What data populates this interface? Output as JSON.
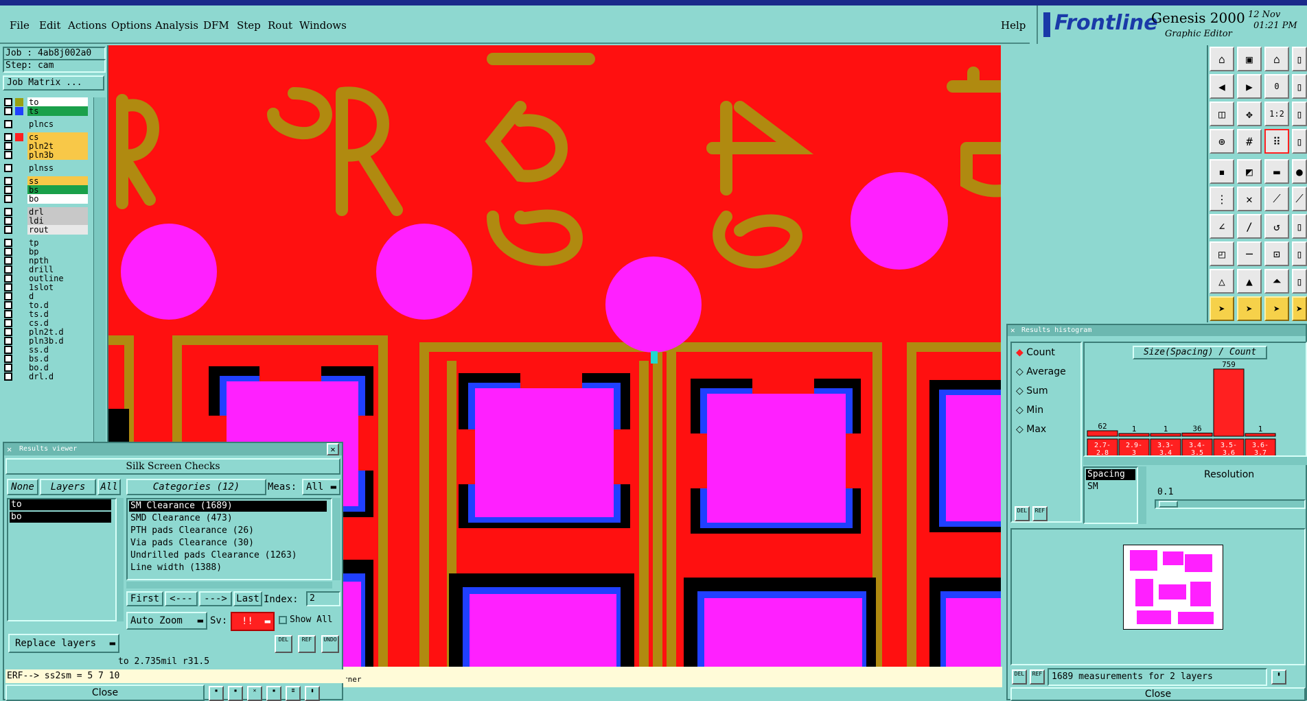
{
  "menu": {
    "items": [
      "File",
      "Edit",
      "Actions",
      "Options",
      "Analysis",
      "DFM",
      "Step",
      "Rout",
      "Windows"
    ],
    "help": "Help"
  },
  "brand": {
    "logo": "Frontline",
    "product": "Genesis 2000",
    "subtitle": "Graphic Editor",
    "date": "12 Nov",
    "time": "01:21 PM"
  },
  "job": {
    "job_label": "Job : 4ab8j002a0",
    "step_label": "Step: cam",
    "matrix_button": "Job Matrix ..."
  },
  "layers": [
    {
      "name": "to",
      "color": "#ffffff",
      "swatch": "#9aa010",
      "style": "active"
    },
    {
      "name": "ts",
      "color": "#1aa04a",
      "swatch": "#2040ff"
    },
    {
      "name": "plncs",
      "color": "#8ed8d0",
      "swatch": ""
    },
    {
      "name": "cs",
      "color": "#f8c848",
      "swatch": "#ff2020"
    },
    {
      "name": "pln2t",
      "color": "#f8c848",
      "swatch": ""
    },
    {
      "name": "pln3b",
      "color": "#f8c848",
      "swatch": ""
    },
    {
      "name": "plnss",
      "color": "#8ed8d0",
      "swatch": ""
    },
    {
      "name": "ss",
      "color": "#f8c848",
      "swatch": ""
    },
    {
      "name": "bs",
      "color": "#1aa04a",
      "swatch": ""
    },
    {
      "name": "bo",
      "color": "#ffffff",
      "swatch": ""
    },
    {
      "name": "drl",
      "color": "#c8c8c8",
      "swatch": ""
    },
    {
      "name": "ldi",
      "color": "#c8c8c8",
      "swatch": ""
    },
    {
      "name": "rout",
      "color": "#e8e8e8",
      "swatch": ""
    },
    {
      "name": "tp",
      "color": "#8ed8d0",
      "swatch": ""
    },
    {
      "name": "bp",
      "color": "#8ed8d0",
      "swatch": ""
    },
    {
      "name": "npth",
      "color": "#8ed8d0",
      "swatch": ""
    },
    {
      "name": "drill",
      "color": "#8ed8d0",
      "swatch": ""
    },
    {
      "name": "outline",
      "color": "#8ed8d0",
      "swatch": ""
    },
    {
      "name": "1slot",
      "color": "#8ed8d0",
      "swatch": ""
    },
    {
      "name": "d",
      "color": "#8ed8d0",
      "swatch": ""
    },
    {
      "name": "to.d",
      "color": "#8ed8d0",
      "swatch": ""
    },
    {
      "name": "ts.d",
      "color": "#8ed8d0",
      "swatch": ""
    },
    {
      "name": "cs.d",
      "color": "#8ed8d0",
      "swatch": ""
    },
    {
      "name": "pln2t.d",
      "color": "#8ed8d0",
      "swatch": ""
    },
    {
      "name": "pln3b.d",
      "color": "#8ed8d0",
      "swatch": ""
    },
    {
      "name": "ss.d",
      "color": "#8ed8d0",
      "swatch": ""
    },
    {
      "name": "bs.d",
      "color": "#8ed8d0",
      "swatch": ""
    },
    {
      "name": "bo.d",
      "color": "#8ed8d0",
      "swatch": ""
    },
    {
      "name": "drl.d",
      "color": "#8ed8d0",
      "swatch": ""
    }
  ],
  "canvas": {
    "silk_labels": [
      "R15",
      "153",
      "49",
      "45"
    ],
    "status_corner": "rner"
  },
  "results_viewer": {
    "title": "Results viewer",
    "header": "Silk Screen Checks",
    "none_btn": "None",
    "layers_btn": "Layers",
    "all_btn": "All",
    "categories_btn": "Categories (12)",
    "meas_label": "Meas:",
    "meas_value": "All",
    "layer_list": [
      "to",
      "bo"
    ],
    "categories": [
      "SM Clearance (1689)",
      "SMD Clearance (473)",
      "PTH pads Clearance (26)",
      "Via pads Clearance (30)",
      "Undrilled pads Clearance (1263)",
      "Line width (1388)"
    ],
    "first_btn": "First",
    "prev_btn": "<---",
    "next_btn": "--->",
    "last_btn": "Last",
    "index_label": "Index:",
    "index_value": "2",
    "auto_zoom": "Auto Zoom",
    "sv_label": "Sv:",
    "sv_value": "!!",
    "show_all": "Show All",
    "replace_layers": "Replace layers",
    "del_label": "DEL",
    "ref_label": "REF",
    "undo_label": "UNDO",
    "status_line": "to 2.735mil   r31.5",
    "erf_line": "ERF--> ss2sm = 5 7 10",
    "close_btn": "Close"
  },
  "histogram": {
    "title": "Results histogram",
    "modes": [
      "Count",
      "Average",
      "Sum",
      "Min",
      "Max"
    ],
    "selected_mode": "Count",
    "chart_title": "Size(Spacing) / Count",
    "del_label": "DEL",
    "ref_label": "REF",
    "spacing_list": [
      "Spacing",
      "SM"
    ],
    "resolution_label": "Resolution",
    "resolution_value": "0.1",
    "measurements": "1689 measurements for 2 layers",
    "close_btn": "Close"
  },
  "chart_data": {
    "type": "bar",
    "title": "Size(Spacing) / Count",
    "categories": [
      "2.7-2.8",
      "2.9-3",
      "3.3-3.4",
      "3.4-3.5",
      "3.5-3.6",
      "3.6-3.7"
    ],
    "values": [
      62,
      1,
      1,
      36,
      759,
      1
    ]
  }
}
